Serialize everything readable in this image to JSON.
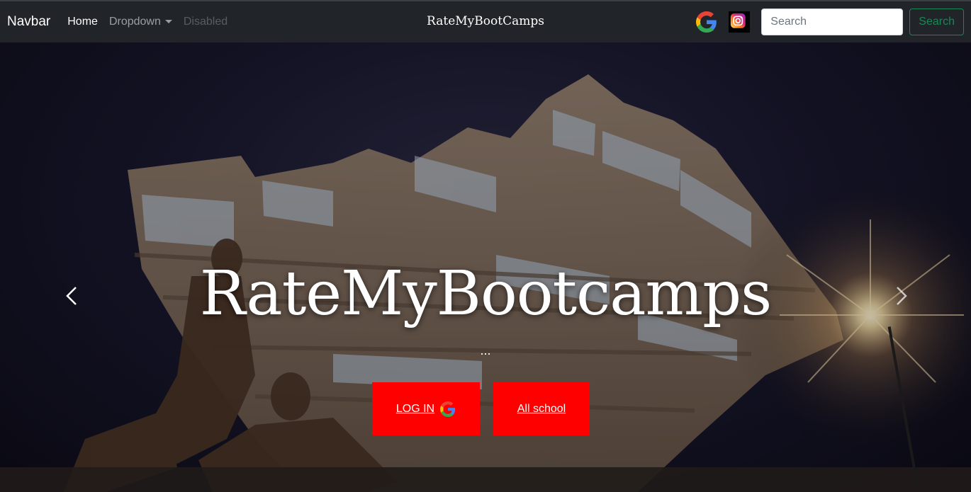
{
  "navbar": {
    "brand": "Navbar",
    "links": [
      {
        "label": "Home"
      },
      {
        "label": "Dropdown"
      },
      {
        "label": "Disabled"
      }
    ],
    "center_title": "RateMyBootCamps",
    "search": {
      "placeholder": "Search",
      "button_label": "Search"
    }
  },
  "hero": {
    "title": "RateMyBootcamps",
    "subtitle": "...",
    "login_label": "LOG IN",
    "all_school_label": "All school"
  },
  "colors": {
    "navbar_bg": "#212529",
    "cta_red": "#ff0000",
    "search_green": "#198754"
  },
  "icons": [
    "google-icon",
    "instagram-icon",
    "chevron-left-icon",
    "chevron-right-icon"
  ]
}
